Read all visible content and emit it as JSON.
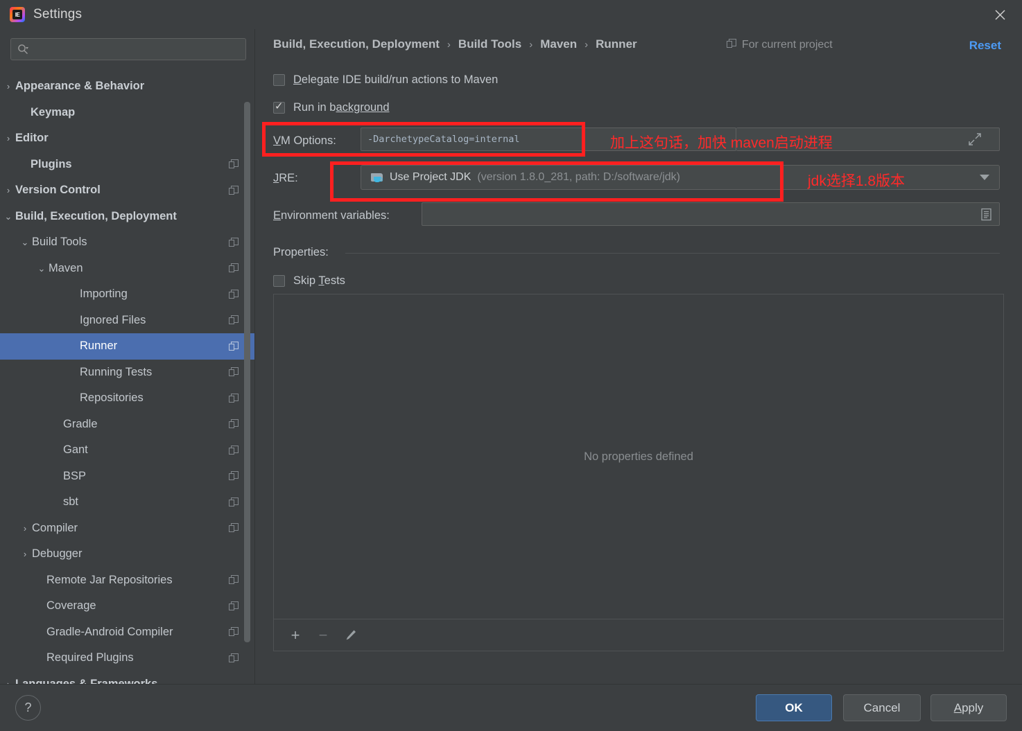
{
  "window": {
    "title": "Settings",
    "logo_text": "IE",
    "close_icon": "close-icon"
  },
  "sidebar": {
    "search": {
      "value": "",
      "placeholder": ""
    },
    "items": [
      {
        "label": "Appearance & Behavior",
        "arrow": "›",
        "indent": 22,
        "bold": true,
        "badge": false,
        "selected": false
      },
      {
        "label": "Keymap",
        "arrow": "",
        "indent": 44,
        "bold": true,
        "badge": false,
        "selected": false
      },
      {
        "label": "Editor",
        "arrow": "›",
        "indent": 22,
        "bold": true,
        "badge": false,
        "selected": false
      },
      {
        "label": "Plugins",
        "arrow": "",
        "indent": 44,
        "bold": true,
        "badge": true,
        "selected": false
      },
      {
        "label": "Version Control",
        "arrow": "›",
        "indent": 22,
        "bold": true,
        "badge": true,
        "selected": false
      },
      {
        "label": "Build, Execution, Deployment",
        "arrow": "⌄",
        "indent": 22,
        "bold": true,
        "badge": false,
        "selected": false
      },
      {
        "label": "Build Tools",
        "arrow": "⌄",
        "indent": 46,
        "bold": false,
        "badge": true,
        "selected": false
      },
      {
        "label": "Maven",
        "arrow": "⌄",
        "indent": 70,
        "bold": false,
        "badge": true,
        "selected": false
      },
      {
        "label": "Importing",
        "arrow": "",
        "indent": 115,
        "bold": false,
        "badge": true,
        "selected": false
      },
      {
        "label": "Ignored Files",
        "arrow": "",
        "indent": 115,
        "bold": false,
        "badge": true,
        "selected": false
      },
      {
        "label": "Runner",
        "arrow": "",
        "indent": 115,
        "bold": false,
        "badge": true,
        "selected": true
      },
      {
        "label": "Running Tests",
        "arrow": "",
        "indent": 115,
        "bold": false,
        "badge": true,
        "selected": false
      },
      {
        "label": "Repositories",
        "arrow": "",
        "indent": 115,
        "bold": false,
        "badge": true,
        "selected": false
      },
      {
        "label": "Gradle",
        "arrow": "",
        "indent": 91,
        "bold": false,
        "badge": true,
        "selected": false
      },
      {
        "label": "Gant",
        "arrow": "",
        "indent": 91,
        "bold": false,
        "badge": true,
        "selected": false
      },
      {
        "label": "BSP",
        "arrow": "",
        "indent": 91,
        "bold": false,
        "badge": true,
        "selected": false
      },
      {
        "label": "sbt",
        "arrow": "",
        "indent": 91,
        "bold": false,
        "badge": true,
        "selected": false
      },
      {
        "label": "Compiler",
        "arrow": "›",
        "indent": 46,
        "bold": false,
        "badge": true,
        "selected": false
      },
      {
        "label": "Debugger",
        "arrow": "›",
        "indent": 46,
        "bold": false,
        "badge": false,
        "selected": false
      },
      {
        "label": "Remote Jar Repositories",
        "arrow": "",
        "indent": 67,
        "bold": false,
        "badge": true,
        "selected": false
      },
      {
        "label": "Coverage",
        "arrow": "",
        "indent": 67,
        "bold": false,
        "badge": true,
        "selected": false
      },
      {
        "label": "Gradle-Android Compiler",
        "arrow": "",
        "indent": 67,
        "bold": false,
        "badge": true,
        "selected": false
      },
      {
        "label": "Required Plugins",
        "arrow": "",
        "indent": 67,
        "bold": false,
        "badge": true,
        "selected": false
      },
      {
        "label": "Languages & Frameworks",
        "arrow": "›",
        "indent": 22,
        "bold": true,
        "badge": false,
        "selected": false
      }
    ]
  },
  "header": {
    "breadcrumb": [
      "Build, Execution, Deployment",
      "Build Tools",
      "Maven",
      "Runner"
    ],
    "separator": "›",
    "scope_note": "For current project",
    "reset_label": "Reset"
  },
  "form": {
    "delegate_checkbox": {
      "label_before": "D",
      "label_after": "elegate IDE build/run actions to Maven",
      "checked": false
    },
    "run_background_checkbox": {
      "label_before": "Run in b",
      "label_after": "ackground",
      "checked": true
    },
    "vm_options": {
      "label_v": "V",
      "label_rest": "M Options:",
      "value": "-DarchetypeCatalog=internal",
      "expand_icon": "expand-arrows-icon"
    },
    "jre": {
      "label_j": "J",
      "label_rest": "RE:",
      "value_main": "Use Project JDK",
      "value_detail": "(version 1.8.0_281, path: D:/software/jdk)",
      "caret_icon": "chevron-down-icon"
    },
    "env_vars": {
      "label_e": "E",
      "label_rest": "nvironment variables:",
      "value": "",
      "browse_icon": "list-editor-icon"
    },
    "properties": {
      "label": "Properties:",
      "skip_tests": {
        "label_before": "Skip ",
        "label_u": "T",
        "label_after": "ests",
        "checked": false
      },
      "empty_text": "No properties defined",
      "toolbar": {
        "add": "+",
        "remove": "−",
        "edit": "pencil-icon"
      }
    }
  },
  "annotations": [
    {
      "text": "加上这句话，加快 maven启动进程",
      "color": "#ff2a2a"
    },
    {
      "text": "jdk选择1.8版本",
      "color": "#ff2a2a"
    }
  ],
  "footer": {
    "help_label": "?",
    "ok_label": "OK",
    "cancel_label": "Cancel",
    "apply_before": "A",
    "apply_after": "pply"
  }
}
